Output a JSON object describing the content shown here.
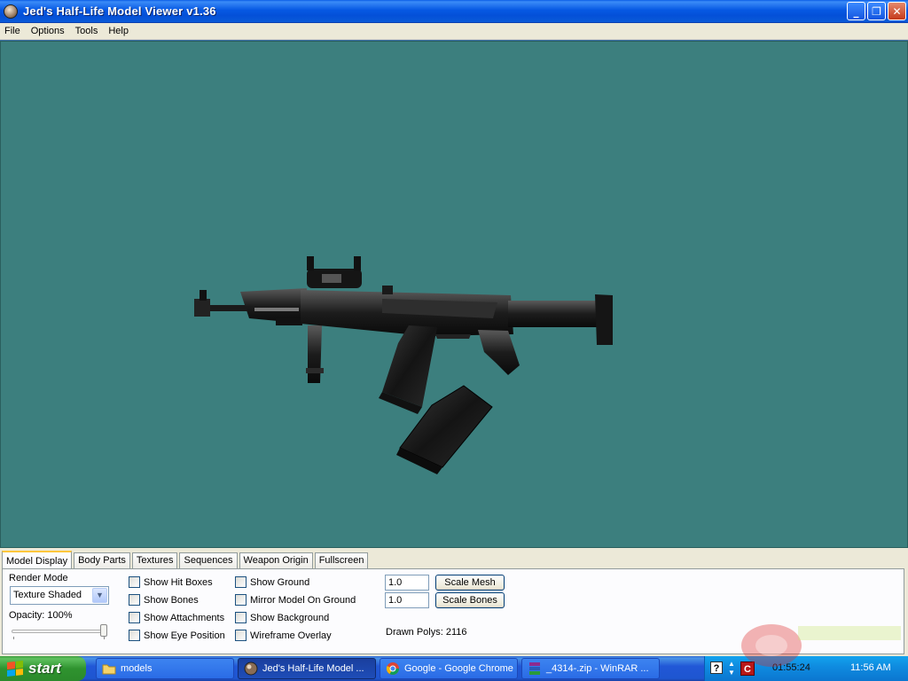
{
  "window": {
    "title": "Jed's Half-Life Model Viewer v1.36",
    "buttons": {
      "minimize": "_",
      "maximize": "❐",
      "close": "✕"
    }
  },
  "menu": [
    "File",
    "Options",
    "Tools",
    "Help"
  ],
  "viewport": {
    "background_color": "#3c7f7e",
    "model": "ak-47 rifle with scope and foregrip, detached magazine"
  },
  "tabs": [
    "Model Display",
    "Body Parts",
    "Textures",
    "Sequences",
    "Weapon Origin",
    "Fullscreen"
  ],
  "active_tab": "Model Display",
  "model_display": {
    "render_mode_label": "Render Mode",
    "render_mode_value": "Texture Shaded",
    "opacity_label": "Opacity: 100%",
    "opacity_value": 1.0,
    "checkboxes_col1": [
      "Show Hit Boxes",
      "Show Bones",
      "Show Attachments",
      "Show Eye Position"
    ],
    "checkboxes_col2": [
      "Show Ground",
      "Mirror Model On Ground",
      "Show Background",
      "Wireframe Overlay"
    ],
    "scale_mesh_value": "1.0",
    "scale_mesh_button": "Scale Mesh",
    "scale_bones_value": "1.0",
    "scale_bones_button": "Scale Bones",
    "drawn_polys": "Drawn Polys: 2116"
  },
  "taskbar": {
    "start_label": "start",
    "tasks": [
      {
        "label": "models",
        "icon": "folder-icon"
      },
      {
        "label": "Jed's Half-Life Model ...",
        "icon": "hlmv-icon"
      },
      {
        "label": "Google - Google Chrome",
        "icon": "chrome-icon"
      },
      {
        "label": "_4314-.zip - WinRAR ...",
        "icon": "winrar-icon"
      }
    ],
    "tray_timer": "01:55:24",
    "tray_clock": "11:56 AM"
  },
  "colors": {
    "titlebar": "#0a5ce6",
    "viewport": "#3c7f7e",
    "panel": "#ece9d8",
    "taskbar": "#245edb",
    "start": "#3c9b3c"
  }
}
